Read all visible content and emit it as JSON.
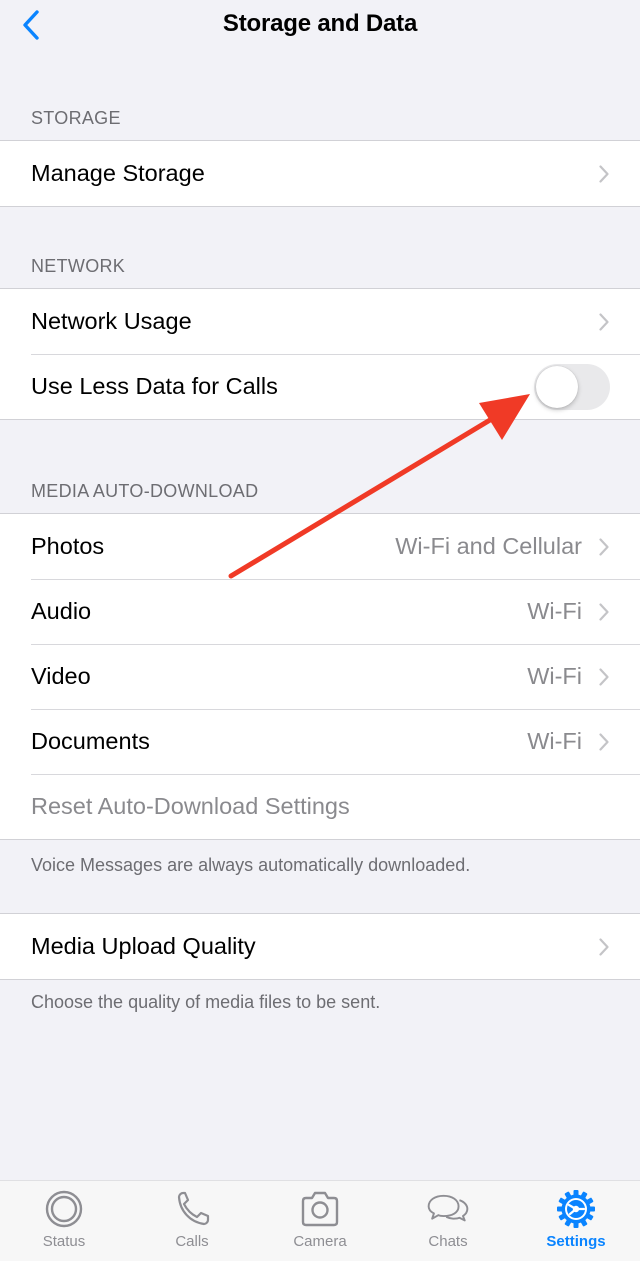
{
  "nav": {
    "title": "Storage and Data"
  },
  "sections": {
    "storage": {
      "header": "STORAGE",
      "manage_storage": "Manage Storage"
    },
    "network": {
      "header": "NETWORK",
      "network_usage": "Network Usage",
      "use_less_data": "Use Less Data for Calls",
      "use_less_data_on": false
    },
    "media": {
      "header": "MEDIA AUTO-DOWNLOAD",
      "photos": {
        "label": "Photos",
        "value": "Wi-Fi and Cellular"
      },
      "audio": {
        "label": "Audio",
        "value": "Wi-Fi"
      },
      "video": {
        "label": "Video",
        "value": "Wi-Fi"
      },
      "documents": {
        "label": "Documents",
        "value": "Wi-Fi"
      },
      "reset": "Reset Auto-Download Settings",
      "footer": "Voice Messages are always automatically downloaded."
    },
    "upload": {
      "label": "Media Upload Quality",
      "footer": "Choose the quality of media files to be sent."
    }
  },
  "tabs": [
    {
      "label": "Status",
      "icon": "status-icon"
    },
    {
      "label": "Calls",
      "icon": "phone-icon"
    },
    {
      "label": "Camera",
      "icon": "camera-icon"
    },
    {
      "label": "Chats",
      "icon": "chat-bubbles-icon"
    },
    {
      "label": "Settings",
      "icon": "gear-icon",
      "active": true
    }
  ],
  "colors": {
    "accent": "#0a84ff",
    "annotation_arrow": "#f03a26",
    "background": "#f2f2f7"
  }
}
